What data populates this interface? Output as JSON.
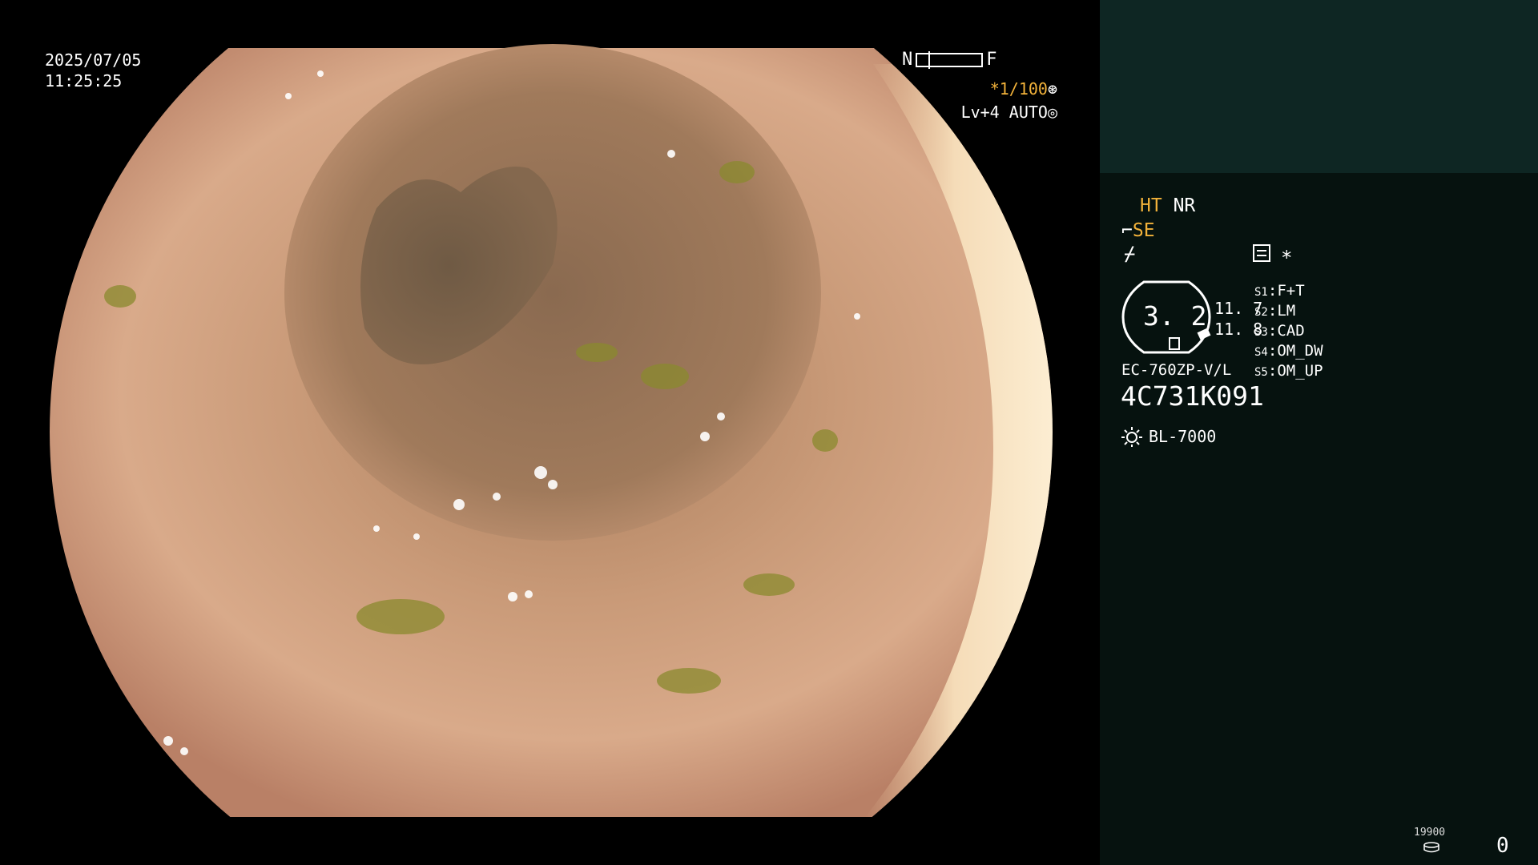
{
  "overlay": {
    "date": "2025/07/05",
    "time": "11:25:25",
    "focus_near": "N",
    "focus_far": "F",
    "shutter_prefix": "*",
    "shutter": "1/100",
    "shutter_icon": "aperture-icon",
    "level": "Lv+4",
    "mode": "AUTO",
    "mode_icon": "iris-icon"
  },
  "panel": {
    "ht": "HT",
    "nr": "NR",
    "se": "SE",
    "se_icon": "hook-icon",
    "wave_icon": "wave-icon",
    "doc_icon": "document-icon",
    "asterisk": "*",
    "gauge_value": "3. 2",
    "gauge_num1": "11. 7",
    "gauge_num2": "11. 8",
    "switches": [
      {
        "key": "S1",
        "value": "F+T"
      },
      {
        "key": "S2",
        "value": "LM"
      },
      {
        "key": "S3",
        "value": "CAD"
      },
      {
        "key": "S4",
        "value": "OM_DW"
      },
      {
        "key": "S5",
        "value": "OM_UP"
      }
    ],
    "model": "EC-760ZP-V/L",
    "serial": "4C731K091",
    "light_icon": "sun-icon",
    "light_source": "BL-7000",
    "counter_label": "19900",
    "counter_icon": "disk-stack-icon",
    "counter_value": "0"
  },
  "colors": {
    "accent": "#f2b23a",
    "panel_bg": "#06120f",
    "panel_top_bg": "#0e2623"
  }
}
